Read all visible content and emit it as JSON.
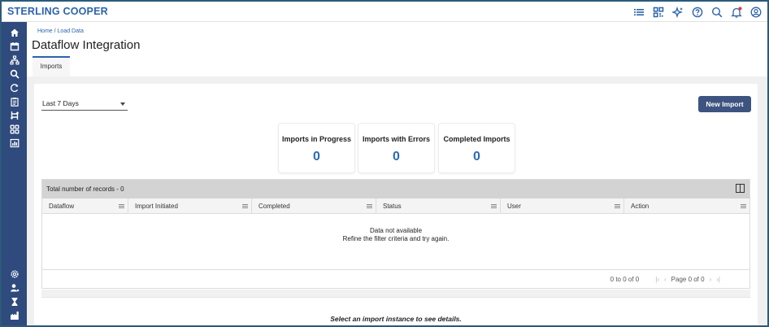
{
  "brand": "STERLING COOPER",
  "topbar_icons": [
    "list-icon",
    "grid-icon",
    "sparkle-icon",
    "help-icon",
    "search-icon",
    "bell-icon",
    "user-icon"
  ],
  "sidebar_icons": [
    "home-icon",
    "calendar-icon",
    "hierarchy-icon",
    "search-icon",
    "refresh-icon",
    "clipboard-icon",
    "transfer-icon",
    "apps-icon",
    "report-icon"
  ],
  "sidebar_bottom_icons": [
    "settings-icon",
    "admin-user-icon",
    "hourglass-icon",
    "factory-icon"
  ],
  "breadcrumb": {
    "home": "Home",
    "sep": " / ",
    "current": "Load Data"
  },
  "page_title": "Dataflow Integration",
  "tabs": [
    {
      "label": "Imports"
    }
  ],
  "filter": {
    "selected": "Last 7 Days"
  },
  "new_import_label": "New Import",
  "cards": [
    {
      "label": "Imports in Progress",
      "value": "0"
    },
    {
      "label": "Imports with Errors",
      "value": "0"
    },
    {
      "label": "Completed Imports",
      "value": "0"
    }
  ],
  "grid": {
    "total_records": "Total number of records - 0",
    "columns": [
      "Dataflow",
      "Import Initiated",
      "Completed",
      "Status",
      "User",
      "Action"
    ],
    "empty_line1": "Data not available",
    "empty_line2": "Refine the filter criteria and try again.",
    "range": "0 to 0 of 0",
    "page_text": "Page 0 of 0"
  },
  "detail_message": "Select an import instance to see details.",
  "colors": {
    "brand": "#2b63ad",
    "sidebar": "#2f4a7d",
    "button": "#3d5480",
    "metric": "#2a6bb5"
  }
}
